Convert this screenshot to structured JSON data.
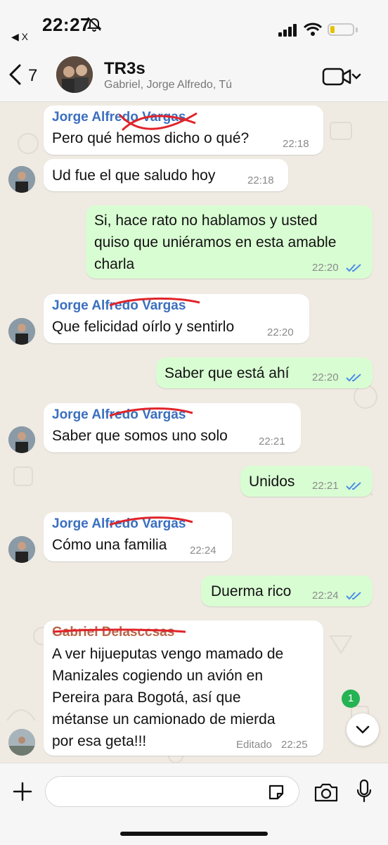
{
  "status_bar": {
    "time": "22:27",
    "back_app_label": "◀ X"
  },
  "header": {
    "back_count": "7",
    "title": "TR3s",
    "members": "Gabriel, Jorge Alfredo, Tú"
  },
  "messages": [
    {
      "direction": "in",
      "sender": "Jorge Alfredo Vargas",
      "text": "Pero qué hemos dicho o qué?",
      "time": "22:18"
    },
    {
      "direction": "in",
      "text": "Ud fue el que saludo hoy",
      "time": "22:18"
    },
    {
      "direction": "out",
      "lines": [
        "Si, hace rato no hablamos y usted",
        "quiso que uniéramos en esta amable",
        "charla"
      ],
      "time": "22:20",
      "status": "read"
    },
    {
      "direction": "in",
      "sender": "Jorge Alfredo Vargas",
      "text": "Que felicidad oírlo y sentirlo",
      "time": "22:20"
    },
    {
      "direction": "out",
      "text": "Saber que está ahí",
      "time": "22:20",
      "status": "read"
    },
    {
      "direction": "in",
      "sender": "Jorge Alfredo Vargas",
      "text": "Saber que somos uno solo",
      "time": "22:21"
    },
    {
      "direction": "out",
      "text": "Unidos",
      "time": "22:21",
      "status": "read"
    },
    {
      "direction": "in",
      "sender": "Jorge Alfredo Vargas",
      "text": "Cómo una familia",
      "time": "22:24"
    },
    {
      "direction": "out",
      "text": "Duerma rico",
      "time": "22:24",
      "status": "read"
    },
    {
      "direction": "in",
      "sender": "Gabriel Delasccsas",
      "lines": [
        "A ver hijueputas vengo mamado de",
        "Manizales cogiendo un avión en",
        "Pereira para Bogotá, así que",
        "métanse un camionado de mierda",
        "por esa geta!!!"
      ],
      "edited_label": "Editado",
      "time": "22:25"
    }
  ],
  "unread_badge": "1",
  "composer": {
    "placeholder": ""
  },
  "colors": {
    "incoming_bubble": "#ffffff",
    "outgoing_bubble": "#d9fdd3",
    "sender_name": "#3b6fbf",
    "sender_name_gabriel": "#b8664a",
    "read_ticks": "#4a8ee6",
    "scribble": "#e0242a",
    "badge": "#25b354"
  },
  "icons": [
    "bell-slash-icon",
    "signal-icon",
    "wifi-icon",
    "battery-icon",
    "back-chevron-icon",
    "video-call-icon",
    "double-check-icon",
    "chevron-down-icon",
    "plus-icon",
    "sticker-icon",
    "camera-icon",
    "microphone-icon"
  ]
}
